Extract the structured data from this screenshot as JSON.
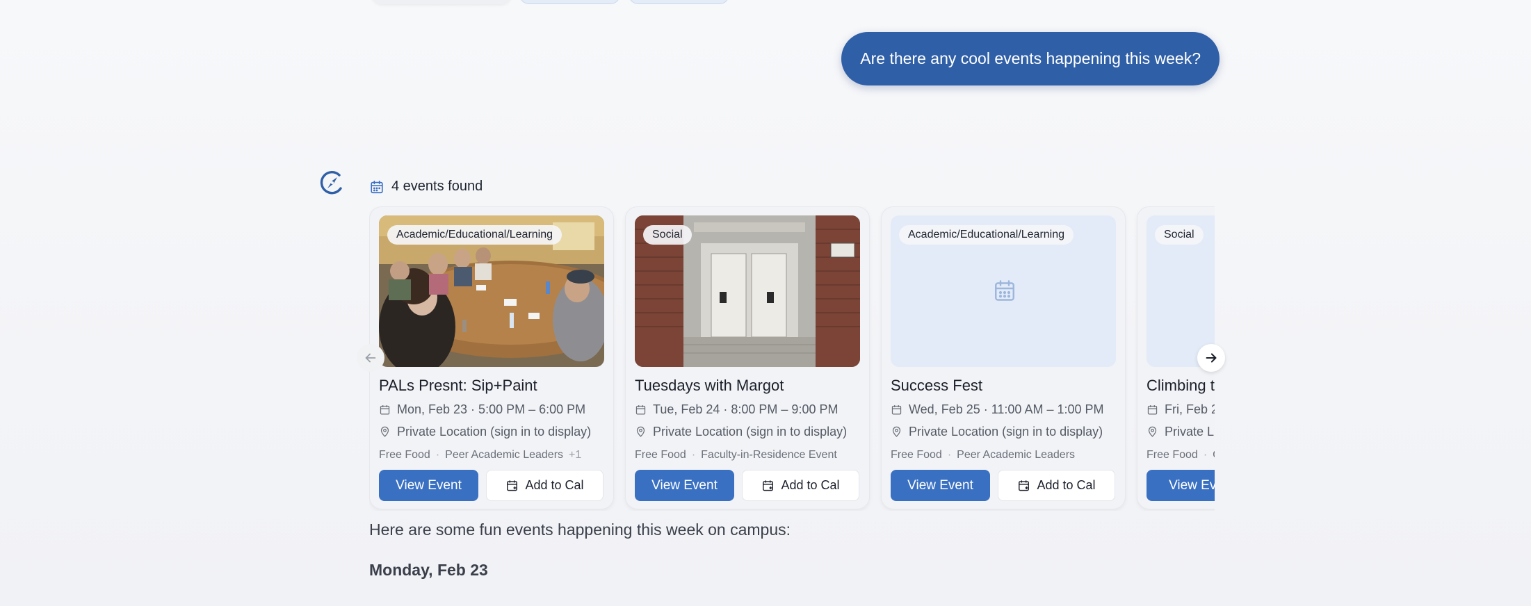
{
  "user_message": "Are there any cool events happening this week?",
  "events_summary": {
    "label": "4 events found",
    "icon": "calendar-icon"
  },
  "colors": {
    "primary": "#3a70c2",
    "bubble": "#2f5fa7",
    "accent_icon": "#2f5fa7"
  },
  "events": [
    {
      "category": "Academic/Educational/Learning",
      "title": "PALs Presnt: Sip+Paint",
      "datetime": "Mon, Feb 23 · 5:00 PM – 6:00 PM",
      "location": "Private Location (sign in to display)",
      "tags": [
        "Free Food",
        "Peer Academic Leaders"
      ],
      "more_tags": "+1",
      "image": "photo-meeting-room",
      "view_label": "View Event",
      "cal_label": "Add to Cal"
    },
    {
      "category": "Social",
      "title": "Tuesdays with Margot",
      "datetime": "Tue, Feb 24 · 8:00 PM – 9:00 PM",
      "location": "Private Location (sign in to display)",
      "tags": [
        "Free Food",
        "Faculty-in-Residence Event"
      ],
      "more_tags": "",
      "image": "photo-building-entrance",
      "view_label": "View Event",
      "cal_label": "Add to Cal"
    },
    {
      "category": "Academic/Educational/Learning",
      "title": "Success Fest",
      "datetime": "Wed, Feb 25 · 11:00 AM – 1:00 PM",
      "location": "Private Location (sign in to display)",
      "tags": [
        "Free Food",
        "Peer Academic Leaders"
      ],
      "more_tags": "",
      "image": "calendar-placeholder",
      "view_label": "View Event",
      "cal_label": "Add to Cal"
    },
    {
      "category": "Social",
      "title": "Climbing t",
      "datetime": "Fri, Feb 2",
      "location": "Private L",
      "tags": [
        "Free Food",
        "C"
      ],
      "more_tags": "",
      "image": "calendar-placeholder",
      "view_label": "View Eve",
      "cal_label": ""
    }
  ],
  "carousel": {
    "prev_icon": "arrow-left-icon",
    "next_icon": "arrow-right-icon"
  },
  "response": {
    "intro": "Here are some fun events happening this week on campus:",
    "first_day_heading": "Monday, Feb 23"
  }
}
